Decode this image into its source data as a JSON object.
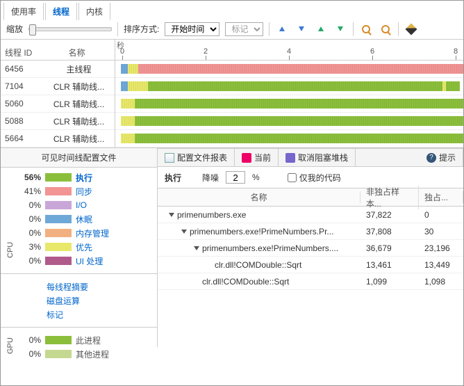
{
  "tabs": {
    "usage": "使用率",
    "threads": "线程",
    "cores": "内核"
  },
  "toolbar": {
    "zoom": "缩放",
    "sort": "排序方式:",
    "sort_opt": "开始时间",
    "marker": "标记"
  },
  "ruler": {
    "unit": "秒",
    "ticks": [
      "0",
      "2",
      "4",
      "6",
      "8"
    ]
  },
  "thead": {
    "id": "线程 ID",
    "name": "名称"
  },
  "threads": [
    {
      "id": "6456",
      "name": "主线程"
    },
    {
      "id": "7104",
      "name": "CLR 辅助线..."
    },
    {
      "id": "5060",
      "name": "CLR 辅助线..."
    },
    {
      "id": "5088",
      "name": "CLR 辅助线..."
    },
    {
      "id": "5664",
      "name": "CLR 辅助线..."
    }
  ],
  "profile": {
    "title": "可见时间线配置文件",
    "cpu": [
      {
        "pct": "56%",
        "color": "#8bbf3b",
        "label": "执行",
        "bold": true
      },
      {
        "pct": "41%",
        "color": "#f29494",
        "label": "同步"
      },
      {
        "pct": "0%",
        "color": "#c9a6d8",
        "label": "I/O"
      },
      {
        "pct": "0%",
        "color": "#6ea8d8",
        "label": "休眠"
      },
      {
        "pct": "0%",
        "color": "#f2b080",
        "label": "内存管理"
      },
      {
        "pct": "3%",
        "color": "#e8e86a",
        "label": "优先"
      },
      {
        "pct": "0%",
        "color": "#b05a8c",
        "label": "UI 处理"
      }
    ],
    "links": [
      "每线程摘要",
      "磁盘运算",
      "标记"
    ],
    "gpu": [
      {
        "pct": "0%",
        "color": "#8bbf3b",
        "label": "此进程"
      },
      {
        "pct": "0%",
        "color": "#c5d890",
        "label": "其他进程"
      }
    ],
    "side_cpu": "CPU",
    "side_gpu": "GPU"
  },
  "report": {
    "tabs": {
      "profile": "配置文件报表",
      "current": "当前",
      "unblock": "取消阻塞堆栈",
      "hint": "提示"
    },
    "exec": "执行",
    "noise": "降噪",
    "noise_val": "2",
    "pct": "%",
    "mycode": "仅我的代码",
    "thead": {
      "name": "名称",
      "inc": "非独占样本...",
      "exc": "独占..."
    },
    "rows": [
      {
        "indent": 0,
        "tog": true,
        "name": "primenumbers.exe",
        "inc": "37,822",
        "exc": "0"
      },
      {
        "indent": 1,
        "tog": true,
        "name": "primenumbers.exe!PrimeNumbers.Pr...",
        "inc": "37,808",
        "exc": "30"
      },
      {
        "indent": 2,
        "tog": true,
        "name": "primenumbers.exe!PrimeNumbers....",
        "inc": "36,679",
        "exc": "23,196"
      },
      {
        "indent": 3,
        "tog": false,
        "name": "clr.dll!COMDouble::Sqrt",
        "inc": "13,461",
        "exc": "13,449"
      },
      {
        "indent": 2,
        "tog": false,
        "name": "clr.dll!COMDouble::Sqrt",
        "inc": "1,099",
        "exc": "1,098"
      }
    ]
  }
}
